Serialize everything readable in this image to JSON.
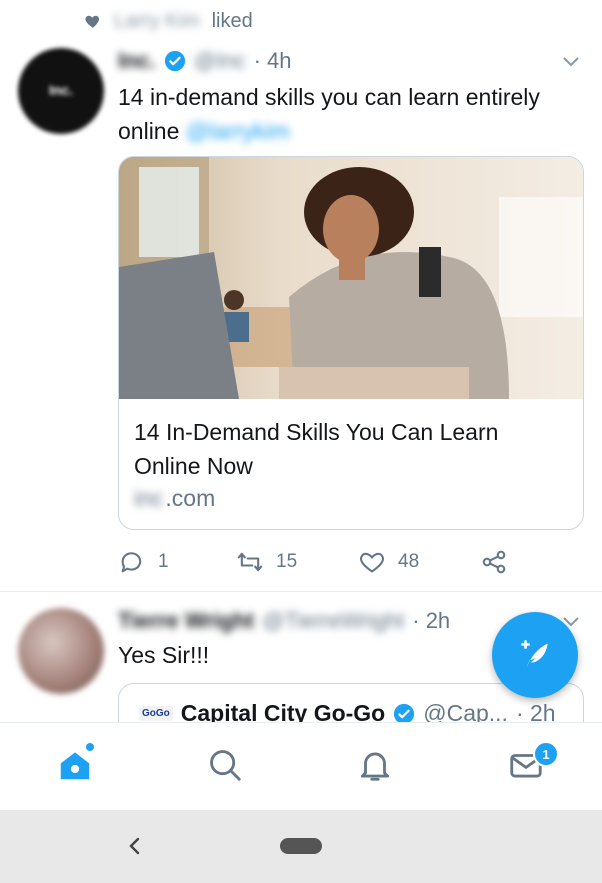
{
  "liked_header": {
    "user": "Larry Kim",
    "action": "liked"
  },
  "tweet1": {
    "avatar_text": "Inc.",
    "name": "Inc.",
    "handle": "@Inc",
    "time": "· 4h",
    "text": "14 in-demand skills you can learn entirely online",
    "mention": "@larrykim",
    "card": {
      "title": "14 In-Demand Skills You Can Learn Online Now",
      "domain_blur": "inc",
      "domain_suffix": ".com"
    },
    "actions": {
      "replies": "1",
      "retweets": "15",
      "likes": "48"
    }
  },
  "tweet2": {
    "name": "Tierre Wright",
    "handle": "@TierreWright",
    "time": "· 2h",
    "text": "Yes Sir!!!",
    "quoted": {
      "logo_text": "GoGo",
      "name": "Capital City Go-Go",
      "handle": "@Cap...",
      "time": "· 2h"
    }
  },
  "nav": {
    "messages_badge": "1"
  },
  "colors": {
    "accent": "#1da1f2",
    "muted": "#657786",
    "border": "#ccd6dd"
  }
}
